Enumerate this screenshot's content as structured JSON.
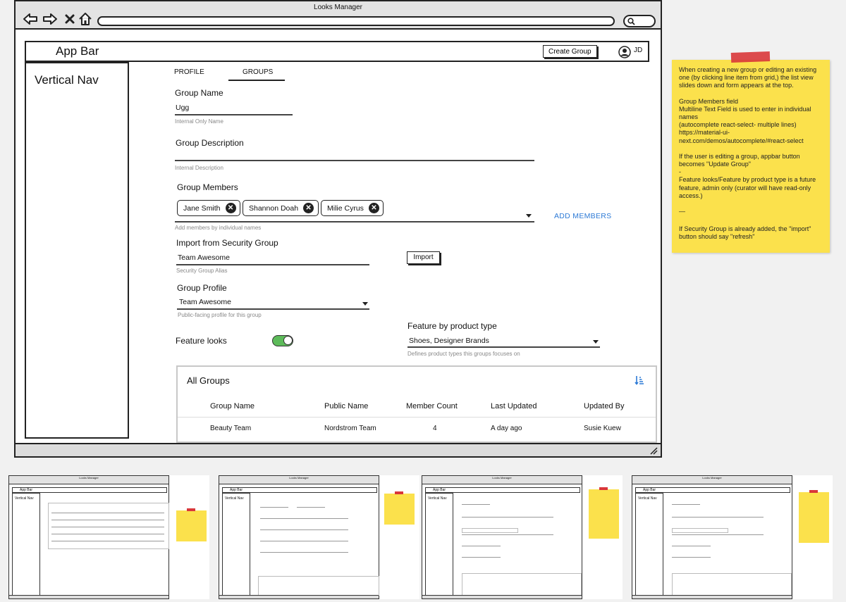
{
  "window": {
    "title": "Looks Manager"
  },
  "appbar": {
    "title": "App Bar",
    "create_button": "Create Group",
    "user_initials": "JD"
  },
  "nav": {
    "title": "Vertical Nav"
  },
  "tabs": [
    {
      "label": "PROFILE"
    },
    {
      "label": "GROUPS",
      "active": true
    }
  ],
  "form": {
    "group_name": {
      "label": "Group Name",
      "value": "Ugg",
      "help": "Internal Only Name"
    },
    "group_description": {
      "label": "Group Description",
      "value": "",
      "help": "Internal Description"
    },
    "group_members": {
      "label": "Group Members",
      "chips": [
        "Jane Smith",
        "Shannon Doah",
        "Milie Cyrus"
      ],
      "help": "Add members by individual names",
      "add_button": "ADD MEMBERS"
    },
    "security_group": {
      "label": "Import from Security Group",
      "value": "Team Awesome",
      "help": "Security Group Alias",
      "import_button": "Import"
    },
    "group_profile": {
      "label": "Group Profile",
      "value": "Team Awesome",
      "help": "Public-facing profile for this group"
    },
    "feature_looks": {
      "label": "Feature looks",
      "enabled": true
    },
    "feature_by_product": {
      "label": "Feature  by product type",
      "value": "Shoes, Designer Brands",
      "help": "Defines product types this groups focuses on"
    }
  },
  "all_groups": {
    "title": "All Groups",
    "columns": [
      "Group Name",
      "Public Name",
      "Member Count",
      "Last Updated",
      "Updated By"
    ],
    "rows": [
      [
        "Beauty Team",
        "Nordstrom Team",
        "4",
        "A day ago",
        "Susie Kuew"
      ]
    ]
  },
  "sticky": {
    "color": "#fbe14c",
    "paragraphs": [
      "When creating a new group or editing an existing one (by clicking line item from grid,) the list view slides down and form appears at the top.",
      "Group Members field\nMultiline Text Field is used to enter in individual names\n(autocomplete  react-select- multiple lines)\nhttps://material-ui-next.com/demos/autocomplete/#react-select",
      "If the user is editing a group, appbar button becomes \"Update Group\"\n-\n Feature looks/Feature by product type is a future feature, admin only (curator will have read-only access.)",
      "—",
      "If Security Group is already added, the \"import\" button should say \"refresh\""
    ]
  },
  "thumbnails": [
    {
      "nav": "Vertical Nav",
      "app": "App Bar"
    },
    {
      "nav": "Vertical Nav",
      "app": "App Bar"
    },
    {
      "nav": "Vertical Nav",
      "app": "App Bar"
    },
    {
      "nav": "Vertical Nav",
      "app": "App Bar"
    }
  ]
}
